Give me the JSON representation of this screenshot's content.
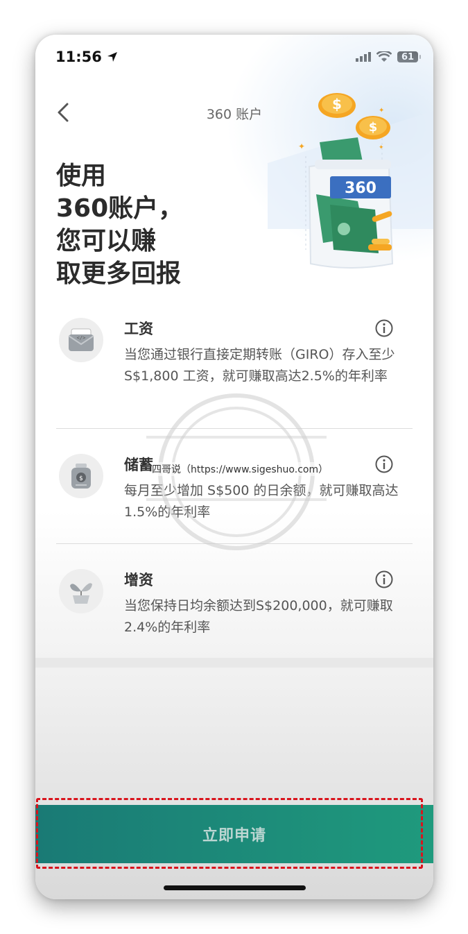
{
  "status_bar": {
    "time": "11:56",
    "battery": "61"
  },
  "nav": {
    "title": "360 账户"
  },
  "hero": {
    "headline": "使用\n360账户，\n您可以赚\n取更多回报",
    "jar_label": "360"
  },
  "features": [
    {
      "title": "工资",
      "desc": "当您通过银行直接定期转账（GIRO）存入至少 S$1,800 工资，就可赚取高达2.5%的年利率"
    },
    {
      "title": "储蓄",
      "desc": "每月至少增加 S$500 的日余额，就可赚取高达1.5%的年利率"
    },
    {
      "title": "增资",
      "desc": "当您保持日均余额达到S$200,000，就可赚取2.4%的年利率"
    }
  ],
  "watermark": "四哥说（https://www.sigeshuo.com）",
  "apply_button": {
    "label": "立即申请"
  },
  "colors": {
    "primary": "#1a7a75",
    "highlight": "#d9141d",
    "gold": "#f5a623",
    "cash_green": "#3a9a6e"
  }
}
